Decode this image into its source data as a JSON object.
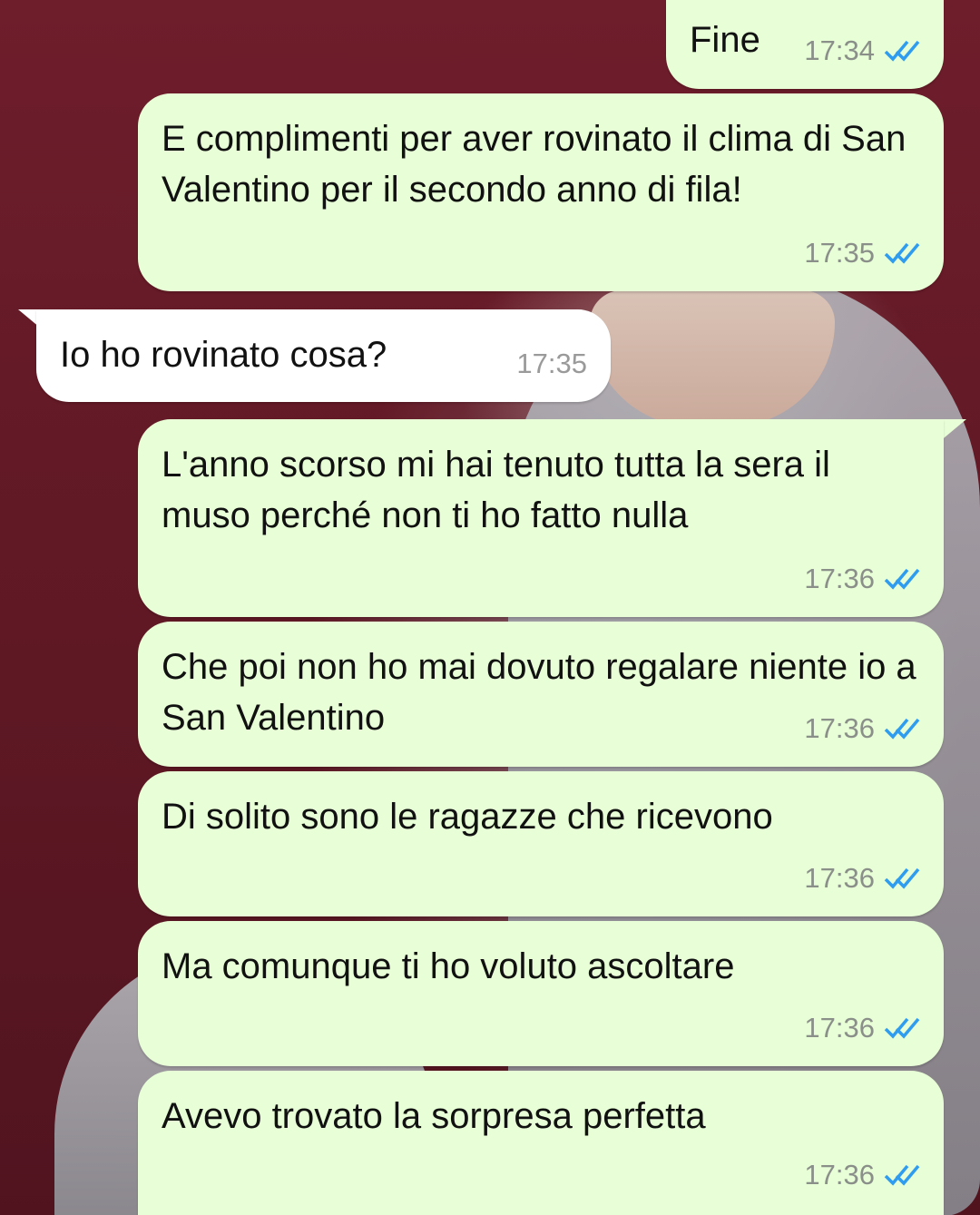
{
  "messages": [
    {
      "text": "Fine",
      "time": "17:34",
      "direction": "outgoing",
      "status_icon": "double-check-read-icon"
    },
    {
      "text": "E complimenti per aver rovinato il clima di San Valentino per il secondo anno di fila!",
      "time": "17:35",
      "direction": "outgoing",
      "status_icon": "double-check-read-icon"
    },
    {
      "text": "Io ho rovinato cosa?",
      "time": "17:35",
      "direction": "incoming"
    },
    {
      "text": "L'anno scorso mi hai tenuto tutta la sera il muso perché non ti ho fatto nulla",
      "time": "17:36",
      "direction": "outgoing",
      "status_icon": "double-check-read-icon"
    },
    {
      "text": "Che poi non ho mai dovuto regalare niente io a San Valentino",
      "time": "17:36",
      "direction": "outgoing",
      "status_icon": "double-check-read-icon"
    },
    {
      "text": "Di solito sono le ragazze che ricevono",
      "time": "17:36",
      "direction": "outgoing",
      "status_icon": "double-check-read-icon"
    },
    {
      "text": "Ma comunque ti ho voluto ascoltare",
      "time": "17:36",
      "direction": "outgoing",
      "status_icon": "double-check-read-icon"
    },
    {
      "text": "Avevo trovato la sorpresa perfetta",
      "time": "17:36",
      "direction": "outgoing",
      "status_icon": "double-check-read-icon"
    }
  ],
  "colors": {
    "outgoing_bubble": "#e7fed6",
    "incoming_bubble": "#ffffff",
    "read_ticks": "#2f9cf0",
    "wallpaper": "#6b1f2a"
  }
}
